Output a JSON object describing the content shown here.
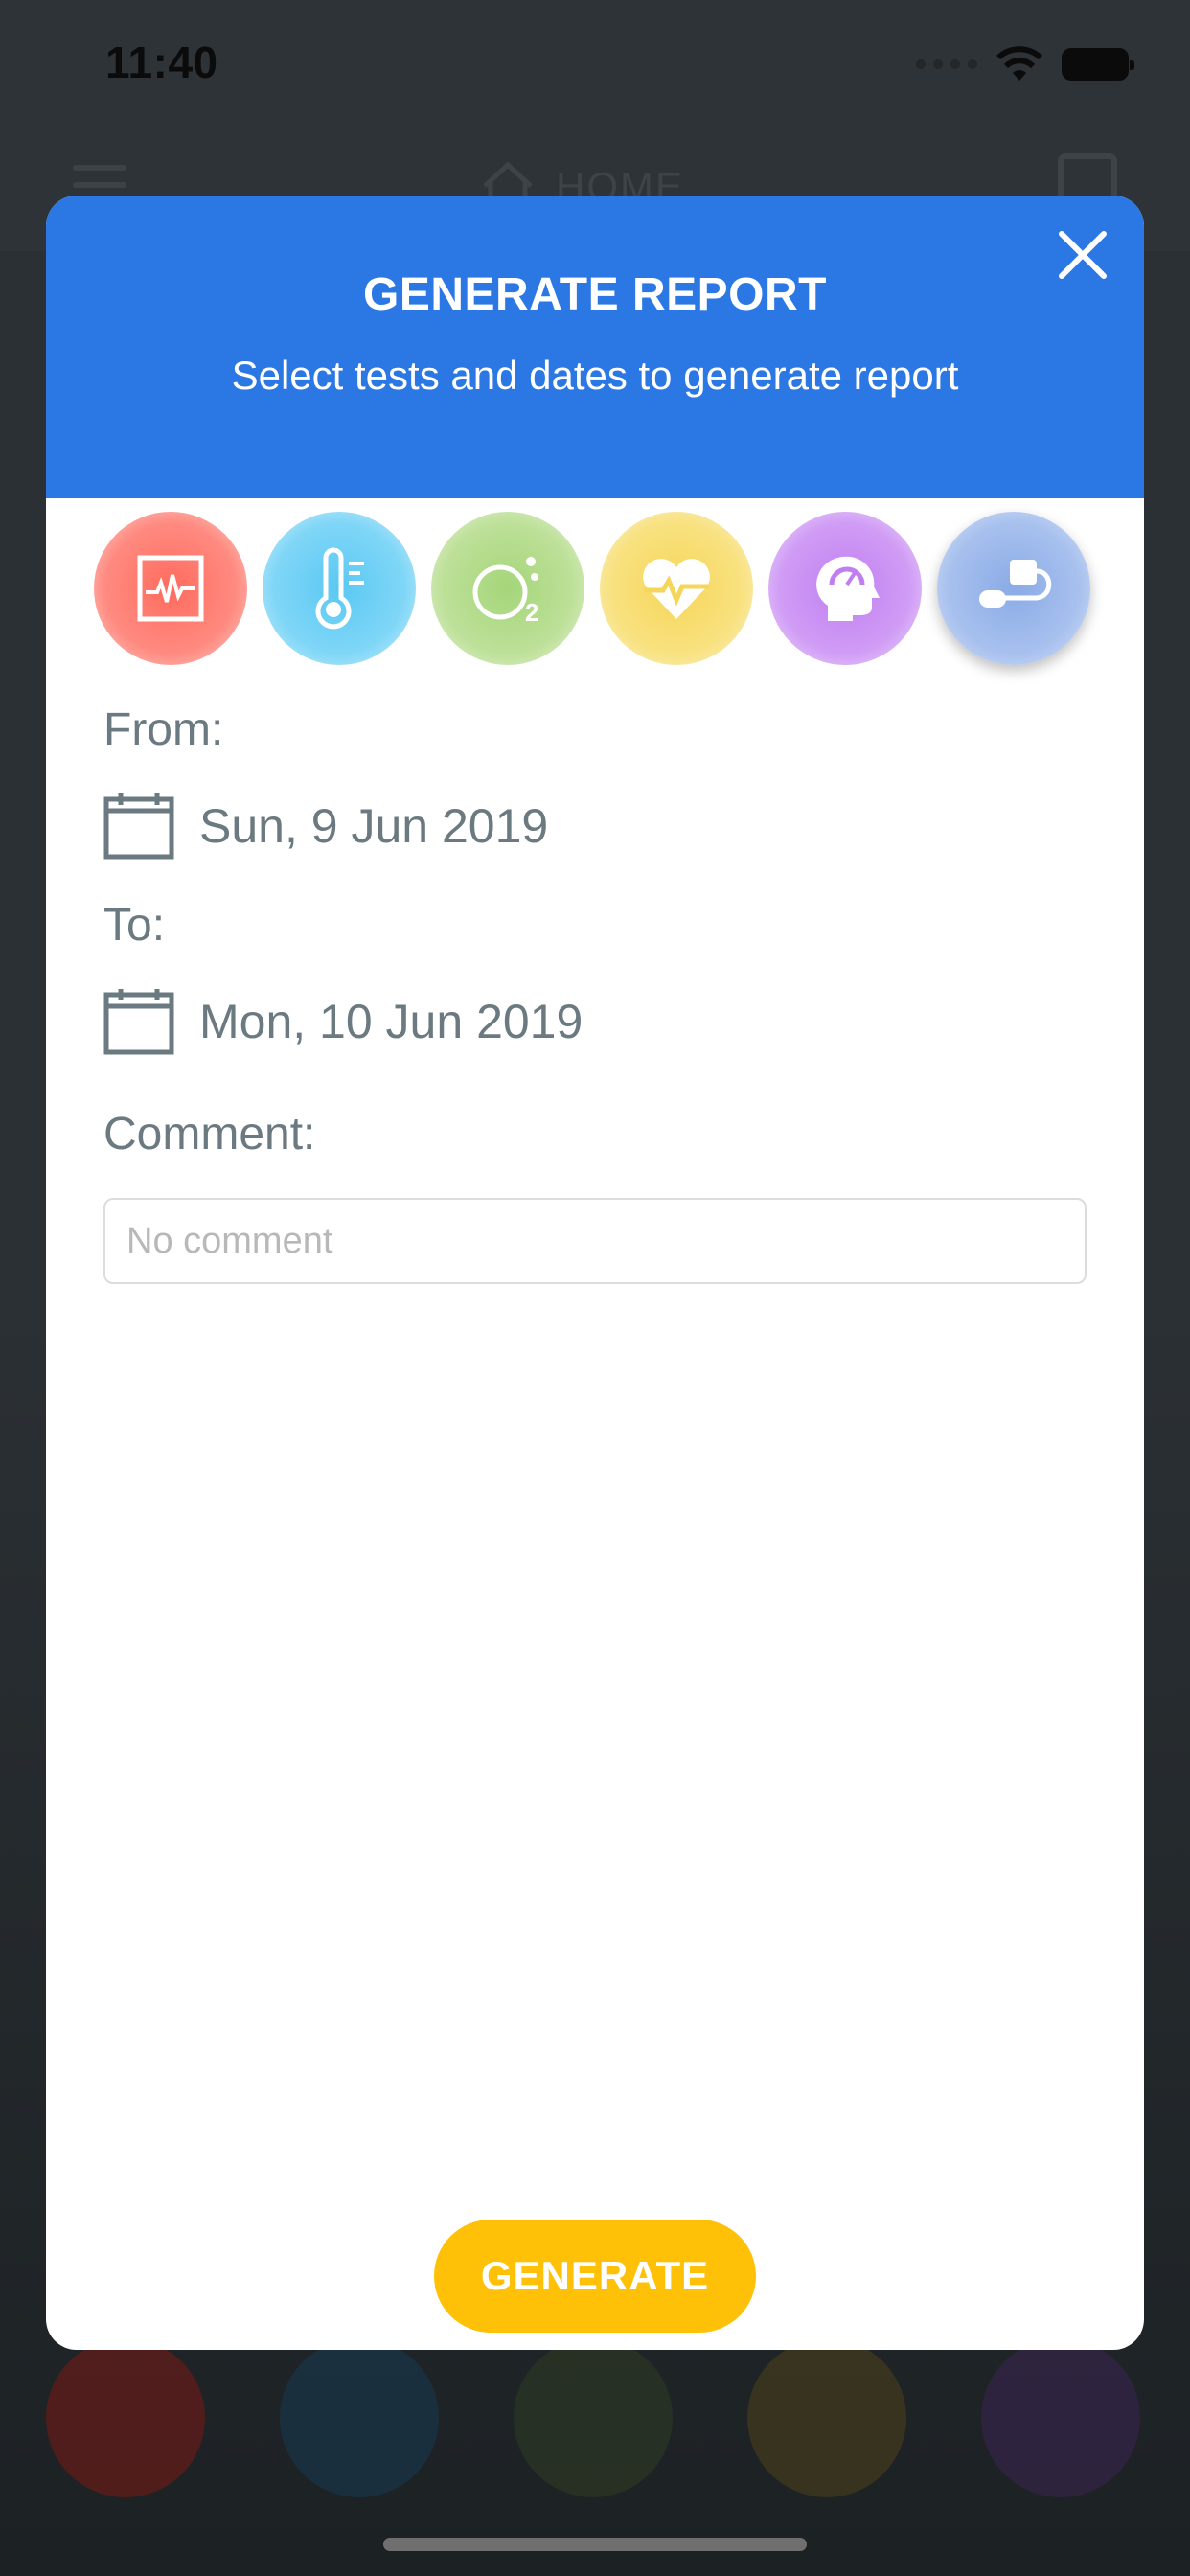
{
  "status_bar": {
    "time": "11:40"
  },
  "background_app": {
    "nav_title": "HOME"
  },
  "modal": {
    "title": "GENERATE REPORT",
    "subtitle": "Select tests and dates to generate report",
    "tests": [
      {
        "name": "ecg-test",
        "icon": "ecg-monitor-icon",
        "color": "#ff6b5e"
      },
      {
        "name": "temperature-test",
        "icon": "thermometer-icon",
        "color": "#66d0f5"
      },
      {
        "name": "oxygen-test",
        "icon": "oxygen-o2-icon",
        "color": "#a9d67a"
      },
      {
        "name": "heart-rate-test",
        "icon": "heartbeat-icon",
        "color": "#f7dc6f"
      },
      {
        "name": "stress-test",
        "icon": "head-gauge-icon",
        "color": "#c58cf2"
      },
      {
        "name": "blood-pressure-test",
        "icon": "blood-pressure-cuff-icon",
        "color": "#8fb0e6"
      }
    ],
    "from_label": "From:",
    "from_date": "Sun, 9 Jun 2019",
    "to_label": "To:",
    "to_date": "Mon, 10 Jun 2019",
    "comment_label": "Comment:",
    "comment_placeholder": "No comment",
    "comment_value": "",
    "generate_label": "GENERATE"
  },
  "colors": {
    "header_blue": "#2b78e4",
    "button_yellow": "#ffc107",
    "text_gray": "#6a7a80"
  }
}
